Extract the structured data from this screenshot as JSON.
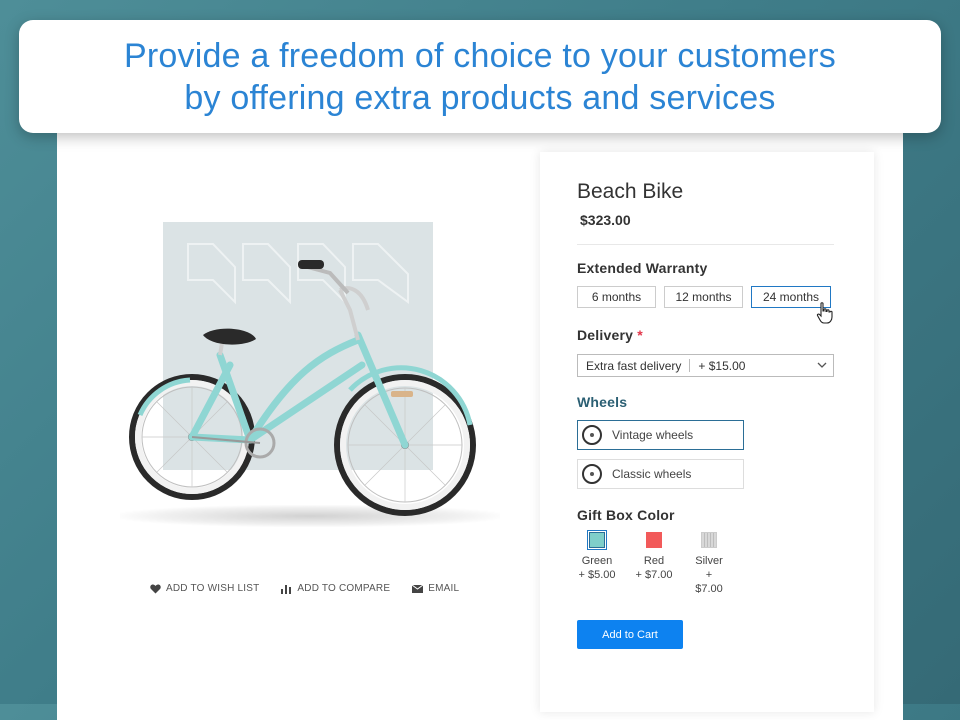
{
  "banner": {
    "line1": "Provide a freedom of choice to your customers",
    "line2": "by offering extra products and services"
  },
  "product": {
    "name": "Beach Bike",
    "price": "$323.00",
    "frame_color": "#8fd6d3"
  },
  "actions": [
    {
      "label": "ADD TO WISH LIST",
      "icon": "heart-icon"
    },
    {
      "label": "ADD TO COMPARE",
      "icon": "bar-chart-icon"
    },
    {
      "label": "EMAIL",
      "icon": "envelope-icon"
    }
  ],
  "warranty": {
    "label": "Extended Warranty",
    "options": [
      "6 months",
      "12 months",
      "24 months"
    ],
    "selected": "24 months"
  },
  "delivery": {
    "label": "Delivery",
    "required_mark": "*",
    "value": "Extra fast delivery",
    "price": "+ $15.00"
  },
  "wheels": {
    "label": "Wheels",
    "options": [
      "Vintage wheels",
      "Classic wheels"
    ],
    "selected": "Vintage wheels"
  },
  "gift_box": {
    "label": "Gift Box Color",
    "options": [
      {
        "name": "Green",
        "price": "+ $5.00",
        "color": "#7fcfca"
      },
      {
        "name": "Red",
        "price": "+ $7.00",
        "color": "#f25a5a"
      },
      {
        "name": "Silver",
        "price": "+ $7.00",
        "color": "#cfcfcf"
      }
    ],
    "selected": "Green"
  },
  "cart": {
    "label": "Add to Cart"
  },
  "colors": {
    "accent": "#0d82f0",
    "banner_text": "#2b84d4",
    "required": "#e2364a"
  }
}
